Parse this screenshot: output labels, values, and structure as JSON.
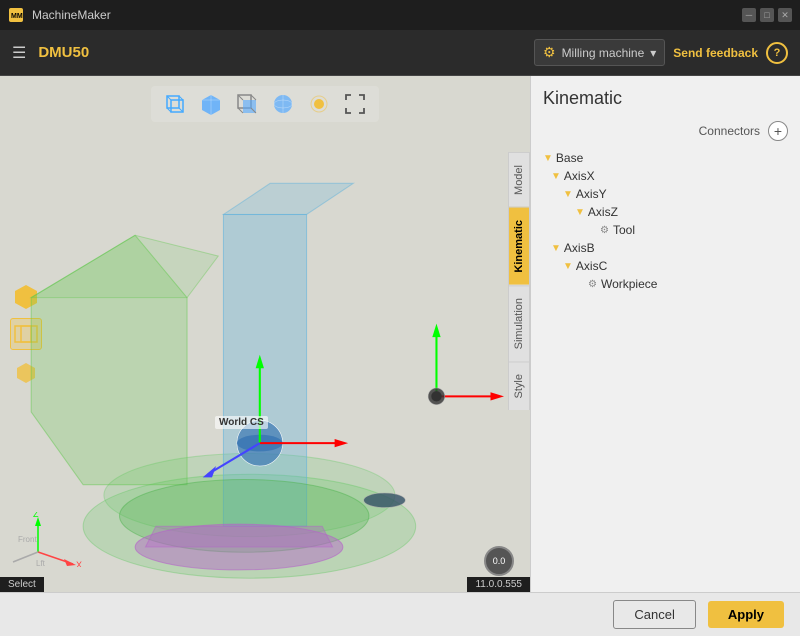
{
  "titlebar": {
    "app_name": "MachineMaker",
    "win_buttons": [
      "minimize",
      "maximize",
      "close"
    ]
  },
  "toolbar": {
    "machine_name": "DMU50",
    "machine_type": "Milling machine",
    "send_feedback_label": "Send feedback",
    "help_label": "?"
  },
  "viewport_toolbar": {
    "buttons": [
      "cube-wire",
      "cube-solid",
      "cube-wire-alt",
      "sphere",
      "dot",
      "expand"
    ]
  },
  "left_panel": {
    "icons": [
      "cube-yellow",
      "cube-wire",
      "cube-small-yellow"
    ]
  },
  "world_cs": "World CS",
  "corner_axes": {
    "labels": [
      "Z",
      "Lft",
      "Front",
      "X"
    ]
  },
  "speed_indicator": "0.0",
  "vtabs": [
    {
      "label": "Model",
      "active": false
    },
    {
      "label": "Kinematic",
      "active": true
    },
    {
      "label": "Simulation",
      "active": false
    },
    {
      "label": "Style",
      "active": false
    }
  ],
  "kinematic": {
    "title": "Kinematic",
    "connectors_label": "Connectors",
    "add_label": "+",
    "tree": [
      {
        "level": 0,
        "arrow": "▼",
        "label": "Base",
        "icon": ""
      },
      {
        "level": 1,
        "arrow": "▼",
        "label": "AxisX",
        "icon": ""
      },
      {
        "level": 2,
        "arrow": "▼",
        "label": "AxisY",
        "icon": ""
      },
      {
        "level": 3,
        "arrow": "▼",
        "label": "AxisZ",
        "icon": ""
      },
      {
        "level": 4,
        "arrow": "",
        "label": "Tool",
        "icon": "⚙"
      },
      {
        "level": 1,
        "arrow": "▼",
        "label": "AxisB",
        "icon": ""
      },
      {
        "level": 2,
        "arrow": "▼",
        "label": "AxisC",
        "icon": ""
      },
      {
        "level": 3,
        "arrow": "",
        "label": "Workpiece",
        "icon": "⚙"
      }
    ]
  },
  "bottom_bar": {
    "cancel_label": "Cancel",
    "apply_label": "Apply"
  },
  "status": {
    "select_label": "Select",
    "version": "11.0.0.555"
  }
}
